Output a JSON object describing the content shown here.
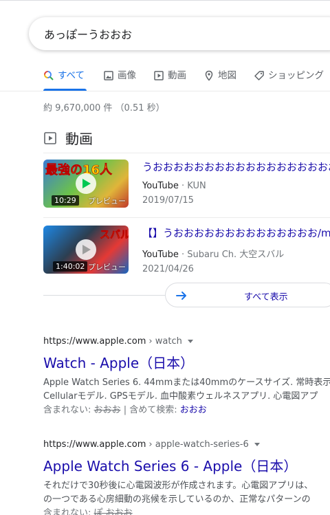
{
  "search": {
    "query": "あっぽーうおおお"
  },
  "tabs": [
    {
      "label": "すべて",
      "icon": "search-icon",
      "active": true
    },
    {
      "label": "画像",
      "icon": "image-icon"
    },
    {
      "label": "動画",
      "icon": "video-icon"
    },
    {
      "label": "地図",
      "icon": "map-pin-icon"
    },
    {
      "label": "ショッピング",
      "icon": "tag-icon"
    }
  ],
  "stats": "約 9,670,000 件 （0.51 秒）",
  "videos": {
    "heading": "動画",
    "items": [
      {
        "title": "うおおおおおおおおおおおおおおおおおお",
        "source": "YouTube",
        "channel": "KUN",
        "date": "2019/07/15",
        "duration": "10:29",
        "preview": "プレビュー",
        "thumb_text": "最強の16人"
      },
      {
        "title": "【】うおおおおおおおおおおおおおお/m",
        "source": "YouTube",
        "channel": "Subaru Ch. 大空スバル",
        "date": "2021/04/26",
        "duration": "1:40:02",
        "preview": "プレビュー",
        "thumb_text": "スバル"
      }
    ],
    "show_all": "すべて表示"
  },
  "results": [
    {
      "domain": "https://www.apple.com",
      "path": "› watch",
      "title": "Watch - Apple（日本）",
      "snippet": [
        "Apple Watch Series 6. 44mmまたは40mmのケースサイズ. 常時表示",
        "Cellularモデル. GPSモデル. 血中酸素ウェルネスアプリ. 心電図アプ"
      ],
      "missing_label": "含まれない:",
      "missing_word": "おおお",
      "with_label": "| 含めて検索:",
      "with_word": "おおお"
    },
    {
      "domain": "https://www.apple.com",
      "path": "› apple-watch-series-6",
      "title": "Apple Watch Series 6 - Apple（日本）",
      "snippet": [
        "それだけで30秒後に心電図波形が作成されます。心電図アプリは、",
        "の一つである心房細動の兆候を示しているのか、正常なパターンの"
      ],
      "missing_label": "含まれない:",
      "missing_word": "ぽ おおお"
    }
  ]
}
